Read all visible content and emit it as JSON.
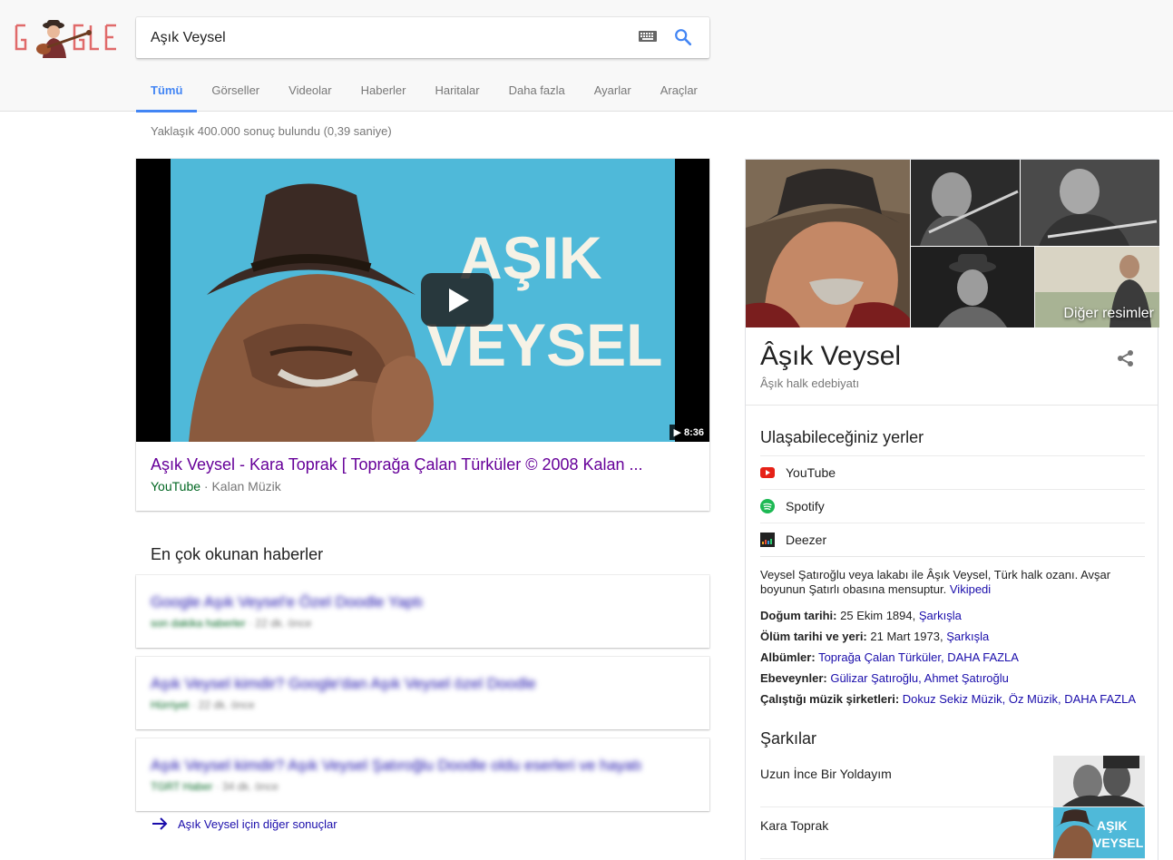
{
  "search": {
    "query": "Aşık Veysel"
  },
  "tabs": [
    {
      "label": "Tümü",
      "active": true
    },
    {
      "label": "Görseller"
    },
    {
      "label": "Videolar"
    },
    {
      "label": "Haberler"
    },
    {
      "label": "Haritalar"
    },
    {
      "label": "Daha fazla"
    },
    {
      "label": "Ayarlar"
    },
    {
      "label": "Araçlar"
    }
  ],
  "result_stats": "Yaklaşık 400.000 sonuç bulundu (0,39 saniye)",
  "video": {
    "thumb_text_line1": "AŞIK",
    "thumb_text_line2": "VEYSEL",
    "duration": "8:36",
    "title": "Aşık Veysel - Kara Toprak [ Toprağa Çalan Türküler © 2008 Kalan ...",
    "source": "YouTube",
    "channel": "· Kalan Müzik"
  },
  "news": {
    "heading": "En çok okunan haberler",
    "items": [
      {
        "title": "Google Aşık Veysel'e Özel Doodle Yaptı",
        "source": "son dakika haberler",
        "age": "· 22 dk. önce"
      },
      {
        "title": "Aşık Veysel kimdir? Google'dan Aşık Veysel özel Doodle",
        "source": "Hürriyet",
        "age": "· 22 dk. önce"
      },
      {
        "title": "Aşık Veysel kimdir? Aşık Veysel Şatıroğlu Doodle oldu eserleri ve hayatı",
        "source": "TGRT Haber",
        "age": "· 34 dk. önce"
      }
    ],
    "more_results": "Aşık Veysel için diğer sonuçlar"
  },
  "knowledge_panel": {
    "more_images": "Diğer resimler",
    "title": "Âşık Veysel",
    "subtitle": "Âşık halk edebiyatı",
    "profiles_heading": "Ulaşabileceğiniz yerler",
    "profiles": [
      {
        "label": "YouTube",
        "icon": "youtube-icon",
        "color": "#e62117"
      },
      {
        "label": "Spotify",
        "icon": "spotify-icon",
        "color": "#1db954"
      },
      {
        "label": "Deezer",
        "icon": "deezer-icon",
        "color": "#222222"
      }
    ],
    "description": "Veysel Şatıroğlu veya lakabı ile Âşık Veysel, Türk halk ozanı. Avşar boyunun Şatırlı obasına mensuptur.",
    "description_link": "Vikipedi",
    "facts": {
      "birth_label": "Doğum tarihi:",
      "birth_value": "25 Ekim 1894,",
      "birth_place": "Şarkışla",
      "death_label": "Ölüm tarihi ve yeri:",
      "death_value": "21 Mart 1973,",
      "death_place": "Şarkışla",
      "albums_label": "Albümler:",
      "albums_value": "Toprağa Çalan Türküler,",
      "albums_more": "DAHA FAZLA",
      "parents_label": "Ebeveynler:",
      "parents_value": "Gülizar Şatıroğlu, Ahmet Şatıroğlu",
      "labels_label": "Çalıştığı müzik şirketleri:",
      "labels_value": "Dokuz Sekiz Müzik, Öz Müzik,",
      "labels_more": "DAHA FAZLA"
    },
    "songs_heading": "Şarkılar",
    "songs": [
      {
        "name": "Uzun İnce Bir Yoldayım"
      },
      {
        "name": "Kara Toprak",
        "thumb_line1": "AŞIK",
        "thumb_line2": "VEYSEL"
      }
    ]
  }
}
